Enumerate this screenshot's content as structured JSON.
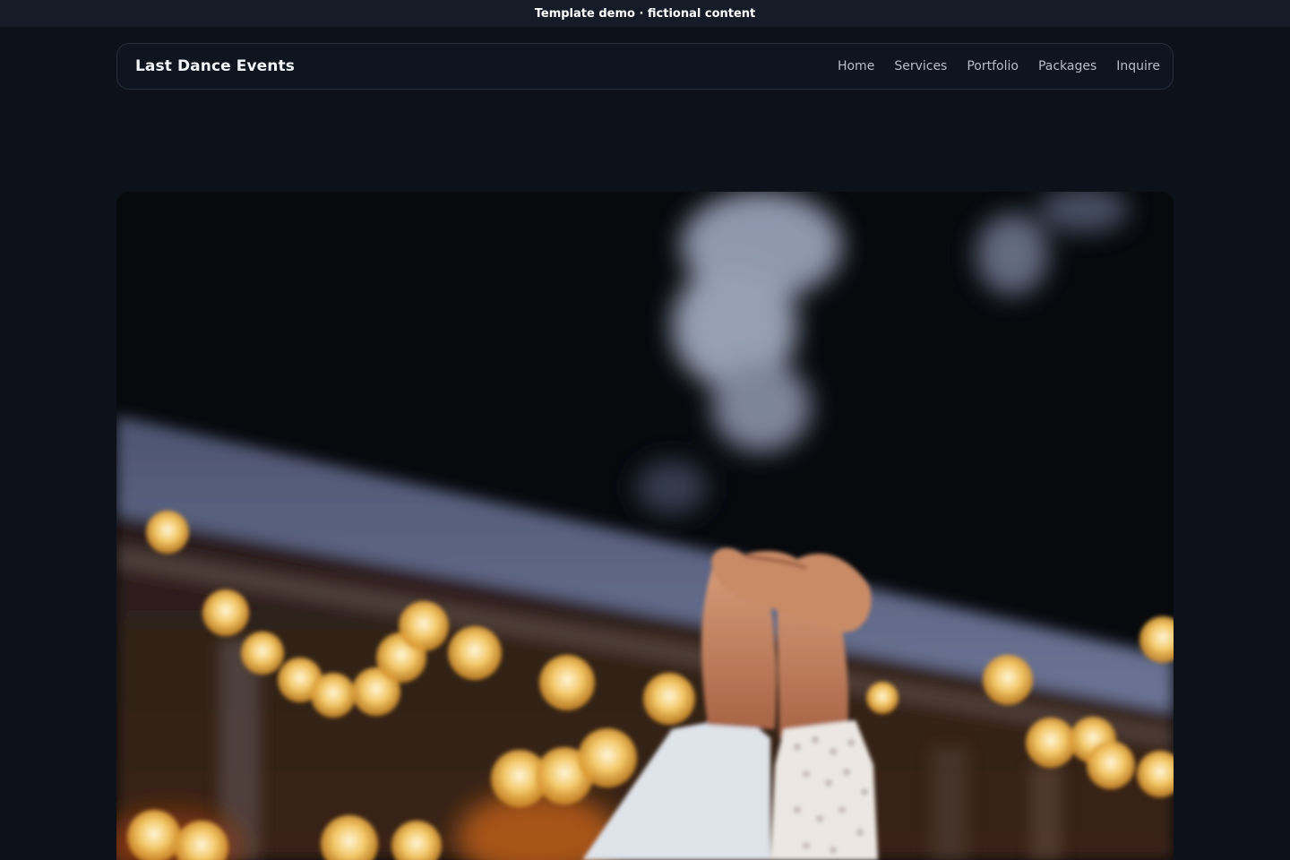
{
  "banner": {
    "text": "Template demo · fictional content"
  },
  "header": {
    "brand": "Last Dance Events",
    "nav": [
      {
        "label": "Home"
      },
      {
        "label": "Services"
      },
      {
        "label": "Portfolio"
      },
      {
        "label": "Packages"
      },
      {
        "label": "Inquire"
      }
    ]
  },
  "hero": {
    "image_subject": "couple-holding-hands-under-string-lights"
  },
  "colors": {
    "page_background": "#0c111a",
    "banner_background": "#161c27",
    "navbar_background": "#0f151f",
    "bokeh_light": "#f3c766"
  }
}
